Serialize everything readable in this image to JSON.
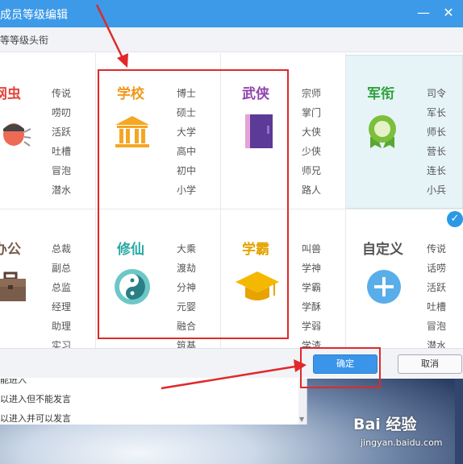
{
  "dialog": {
    "title": "成员等级编辑",
    "subtitle": "等等级头衔",
    "confirm_label": "确定",
    "cancel_label": "取消",
    "close_glyph": "✕",
    "minimize_glyph": "—"
  },
  "chat": {
    "lines": [
      "能进入",
      "以进入但不能发言",
      "以进入并可以发言"
    ]
  },
  "categories": [
    {
      "title": "网虫",
      "color": "#e2463d",
      "icon": "bug-icon",
      "ranks": [
        "传说",
        "唠叨",
        "活跃",
        "吐槽",
        "冒泡",
        "潜水"
      ]
    },
    {
      "title": "学校",
      "color": "#f09a1c",
      "icon": "school-building-icon",
      "ranks": [
        "博士",
        "硕士",
        "大学",
        "高中",
        "初中",
        "小学"
      ]
    },
    {
      "title": "武侠",
      "color": "#8e44ad",
      "icon": "book-icon",
      "ranks": [
        "宗师",
        "掌门",
        "大侠",
        "少侠",
        "师兄",
        "路人"
      ]
    },
    {
      "title": "军衔",
      "color": "#2fa23a",
      "icon": "medal-icon",
      "ranks": [
        "司令",
        "军长",
        "师长",
        "营长",
        "连长",
        "小兵"
      ]
    },
    {
      "title": "办公",
      "color": "#7a5c4a",
      "icon": "briefcase-icon",
      "ranks": [
        "总裁",
        "副总",
        "总监",
        "经理",
        "助理",
        "实习"
      ]
    },
    {
      "title": "修仙",
      "color": "#2aa9a5",
      "icon": "yin-yang-icon",
      "ranks": [
        "大乘",
        "渡劫",
        "分神",
        "元婴",
        "融合",
        "筑基"
      ]
    },
    {
      "title": "学霸",
      "color": "#e4a400",
      "icon": "graduation-cap-icon",
      "ranks": [
        "叫兽",
        "学神",
        "学霸",
        "学酥",
        "学弱",
        "学渣"
      ]
    },
    {
      "title": "自定义",
      "color": "#555555",
      "icon": "plus-icon",
      "ranks": [
        "传说",
        "话唠",
        "活跃",
        "吐槽",
        "冒泡",
        "潜水"
      ]
    }
  ],
  "selected_category": "军衔",
  "watermark": {
    "text": "Bai 经验",
    "url": "jingyan.baidu.com"
  },
  "colors": {
    "accent": "#3d9ae8",
    "annotation_red": "#e0292b",
    "selected_bg": "#e6f4f8"
  }
}
